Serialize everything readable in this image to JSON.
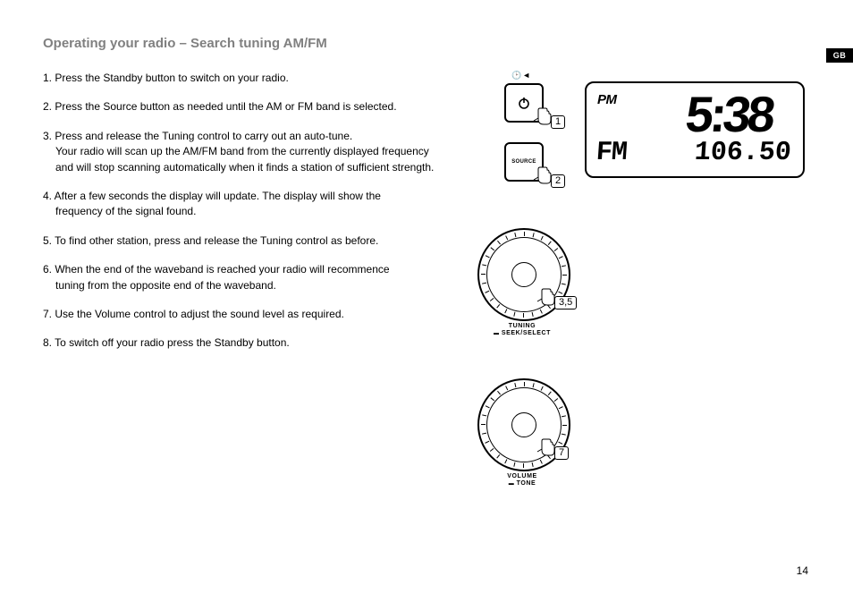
{
  "heading": "Operating your radio – Search tuning AM/FM",
  "lang_tab": "GB",
  "page_number": "14",
  "steps": {
    "s1": "1. Press the Standby button to switch on your radio.",
    "s2": "2. Press the Source button as needed until the AM or FM band is selected.",
    "s3a": "3. Press and release the Tuning control to carry out an auto-tune.",
    "s3b": "Your radio will scan up the AM/FM band from the currently displayed frequency and will stop scanning automatically when it finds a station of sufficient strength.",
    "s4a": "4. After a few seconds the display will update. The display will show the",
    "s4b": "frequency of the signal found.",
    "s5": "5. To find other station, press and release the Tuning control as before.",
    "s6a": "6. When the end of the waveband is reached your radio will recommence",
    "s6b": "tuning from the opposite end of the waveband.",
    "s7": "7. Use the Volume control to adjust the sound level as required.",
    "s8": "8. To switch off your radio press the Standby button."
  },
  "figure": {
    "standby_step": "1",
    "source_label": "SOURCE",
    "source_step": "2",
    "tuning_step": "3,5",
    "tuning_caption_l1": "TUNING",
    "tuning_caption_l2": "SEEK/SELECT",
    "volume_step": "7",
    "volume_caption_l1": "VOLUME",
    "volume_caption_l2": "TONE"
  },
  "lcd": {
    "ampm": "PM",
    "time": "5:38",
    "band": "FM",
    "frequency": "106.50"
  }
}
